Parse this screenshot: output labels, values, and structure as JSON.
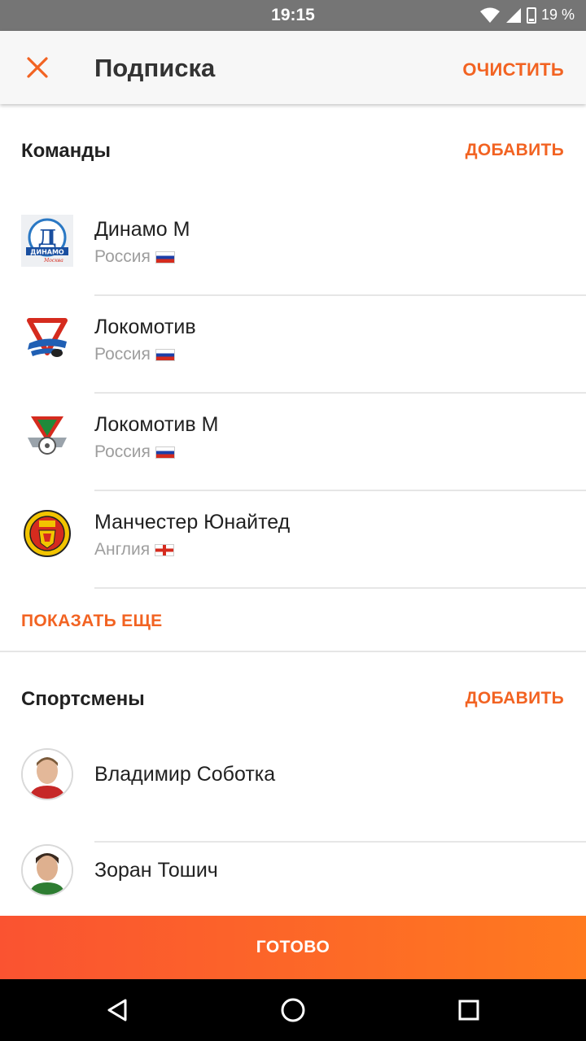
{
  "status_bar": {
    "time": "19:15",
    "battery": "19 %"
  },
  "app_bar": {
    "title": "Подписка",
    "clear_label": "ОЧИСТИТЬ"
  },
  "teams_section": {
    "label": "Команды",
    "add_label": "ДОБАВИТЬ",
    "items": [
      {
        "name": "Динамо М",
        "country": "Россия",
        "flag": "ru",
        "logo": "dynamo-moscow-logo"
      },
      {
        "name": "Локомотив",
        "country": "Россия",
        "flag": "ru",
        "logo": "lokomotiv-hockey-logo"
      },
      {
        "name": "Локомотив М",
        "country": "Россия",
        "flag": "ru",
        "logo": "lokomotiv-moscow-logo"
      },
      {
        "name": "Манчестер Юнайтед",
        "country": "Англия",
        "flag": "en",
        "logo": "manchester-united-logo"
      }
    ],
    "show_more_label": "ПОКАЗАТЬ ЕЩЕ"
  },
  "athletes_section": {
    "label": "Спортсмены",
    "add_label": "ДОБАВИТЬ",
    "items": [
      {
        "name": "Владимир Соботка",
        "avatar": "player-avatar"
      },
      {
        "name": "Зоран Тошич",
        "avatar": "player-avatar"
      }
    ]
  },
  "done_button": {
    "label": "ГОТОВО"
  },
  "colors": {
    "accent": "#f26322",
    "done_gradient_start": "#fa5331",
    "done_gradient_end": "#ff7a1f",
    "status_bar": "#757575"
  },
  "nav_bar": {
    "icons": [
      "back-icon",
      "home-icon",
      "recents-icon"
    ]
  }
}
